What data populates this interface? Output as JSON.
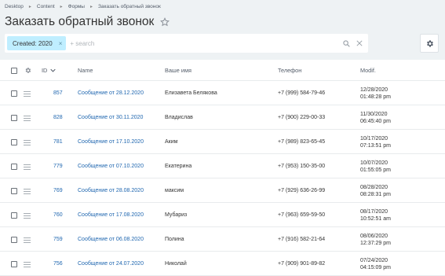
{
  "breadcrumb": [
    "Desktop",
    "Content",
    "Формы",
    "Заказать обратный звонок"
  ],
  "title": "Заказать обратный звонок",
  "filter": {
    "tag": "Created: 2020",
    "tag_close": "×",
    "search_placeholder": "+ search"
  },
  "table": {
    "columns": {
      "id": "ID",
      "name": "Name",
      "your_name": "Ваше имя",
      "phone": "Телефон",
      "modified": "Modif."
    },
    "rows": [
      {
        "id": "857",
        "name": "Сообщение от 28.12.2020",
        "person": "Елизавета Белякова",
        "phone": "+7 (999) 584-79-46",
        "date": "12/28/2020",
        "time": "01:48:28 pm"
      },
      {
        "id": "828",
        "name": "Сообщение от 30.11.2020",
        "person": "Владислав",
        "phone": "+7 (900) 229-00-33",
        "date": "11/30/2020",
        "time": "06:45:40 pm"
      },
      {
        "id": "781",
        "name": "Сообщение от 17.10.2020",
        "person": "Аким",
        "phone": "+7 (989) 823-65-45",
        "date": "10/17/2020",
        "time": "07:13:51 pm"
      },
      {
        "id": "779",
        "name": "Сообщение от 07.10.2020",
        "person": "Екатерина",
        "phone": "+7 (953) 150-35-00",
        "date": "10/07/2020",
        "time": "01:55:05 pm"
      },
      {
        "id": "769",
        "name": "Сообщение от 28.08.2020",
        "person": "максим",
        "phone": "+7 (929) 636-26-99",
        "date": "08/28/2020",
        "time": "08:28:31 pm"
      },
      {
        "id": "760",
        "name": "Сообщение от 17.08.2020",
        "person": "Мубариз",
        "phone": "+7 (963) 659-59-50",
        "date": "08/17/2020",
        "time": "10:52:51 am"
      },
      {
        "id": "759",
        "name": "Сообщение от 06.08.2020",
        "person": "Полина",
        "phone": "+7 (916) 582-21-64",
        "date": "08/06/2020",
        "time": "12:37:29 pm"
      },
      {
        "id": "756",
        "name": "Сообщение от 24.07.2020",
        "person": "Николай",
        "phone": "+7 (909) 901-89-82",
        "date": "07/24/2020",
        "time": "04:15:09 pm"
      }
    ]
  },
  "colors": {
    "background": "#eef2f4",
    "filter_tag": "#bfeeff",
    "link": "#2067b0"
  }
}
